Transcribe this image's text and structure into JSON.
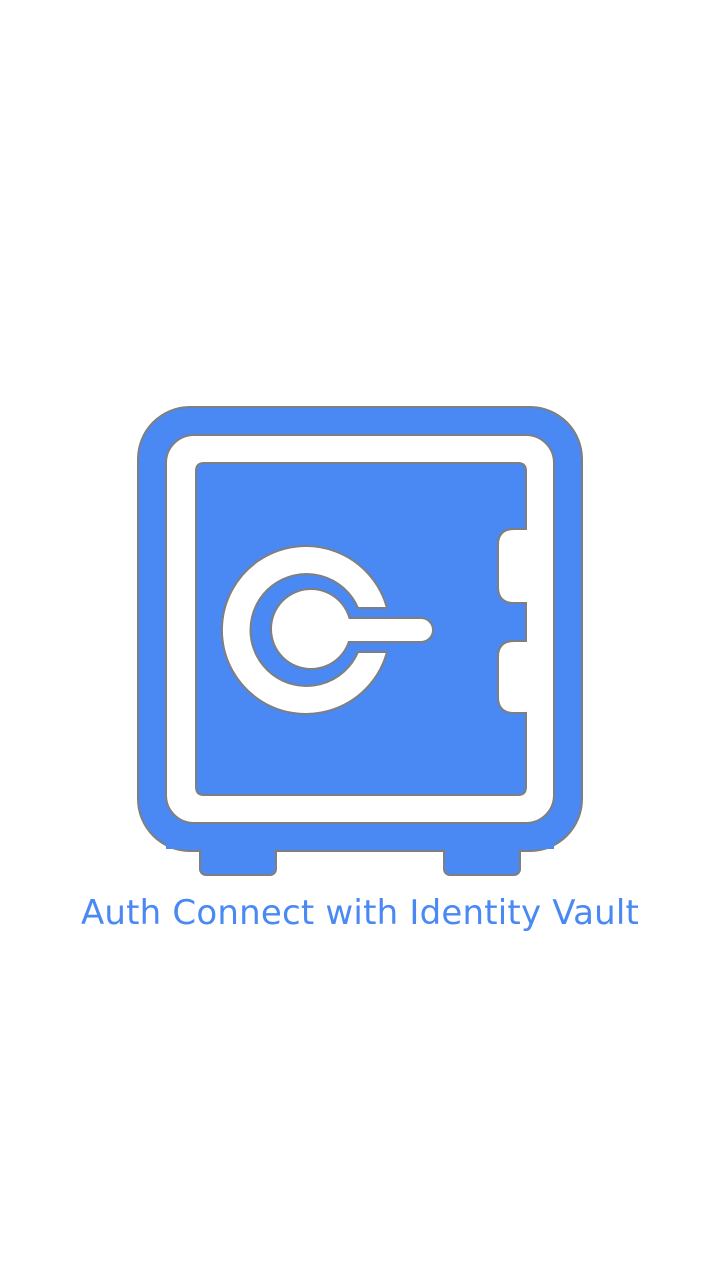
{
  "splash": {
    "logo_icon": "vault-safe-icon",
    "title": "Auth Connect with Identity Vault"
  },
  "colors": {
    "background": "#ffffff",
    "brand_blue": "#4A89F3",
    "outline": "#7f7f7f",
    "inner_white": "#ffffff"
  }
}
